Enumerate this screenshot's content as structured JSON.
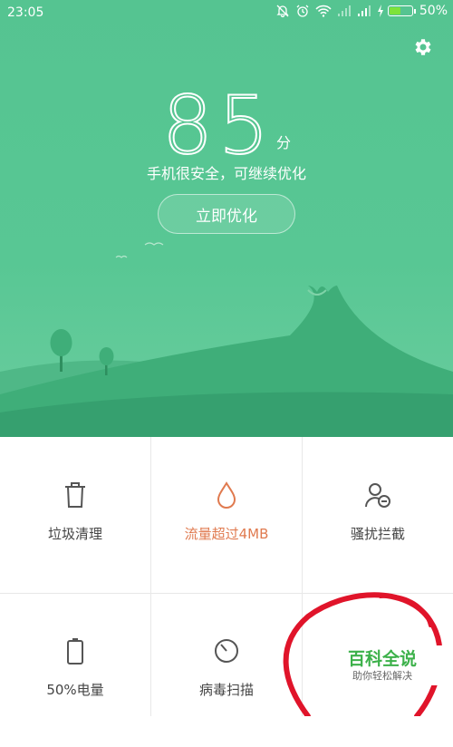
{
  "status_bar": {
    "time": "23:05",
    "battery": "50%",
    "battery_level": 0.5
  },
  "score": {
    "value": "85",
    "unit": "分"
  },
  "subtitle": "手机很安全，可继续优化",
  "optimize_button": "立即优化",
  "grid": {
    "items": [
      {
        "label": "垃圾清理",
        "icon": "trash-icon",
        "color": "#444444"
      },
      {
        "label": "流量超过4MB",
        "icon": "drop-icon",
        "color": "#e07a4f"
      },
      {
        "label": "骚扰拦截",
        "icon": "user-block-icon",
        "color": "#444444"
      },
      {
        "label": "50%电量",
        "icon": "battery-icon",
        "color": "#444444"
      },
      {
        "label": "病毒扫描",
        "icon": "virus-scan-icon",
        "color": "#444444"
      }
    ]
  },
  "watermark": {
    "title": "百科全说",
    "subtitle": "助你轻松解决"
  },
  "colors": {
    "hero_green": "#55c491",
    "accent_orange": "#e07a4f",
    "annotation_red": "#e0142a"
  }
}
